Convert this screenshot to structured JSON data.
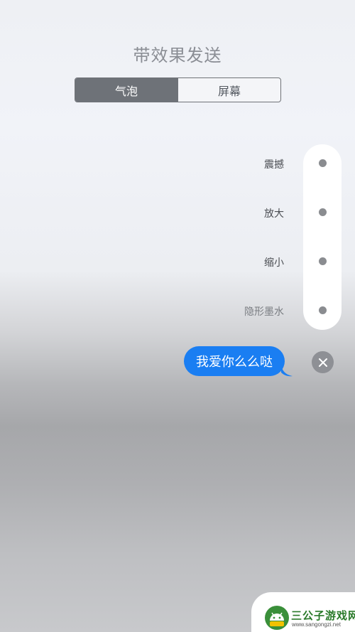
{
  "header": {
    "title": "带效果发送"
  },
  "tabs": [
    {
      "label": "气泡",
      "active": true
    },
    {
      "label": "屏幕",
      "active": false
    }
  ],
  "effects": [
    {
      "label": "震撼"
    },
    {
      "label": "放大"
    },
    {
      "label": "缩小"
    },
    {
      "label": "隐形墨水"
    }
  ],
  "message": {
    "text": "我爱你么么哒"
  },
  "icons": {
    "close": "close-icon",
    "effect_selector": "radio-dot-icon"
  },
  "colors": {
    "bubble": "#1a7ef2",
    "active_tab": "#6e7278",
    "watermark_green": "#2a7a2a"
  },
  "watermark": {
    "name": "三公子游戏网",
    "url": "www.sangongzi.net"
  }
}
